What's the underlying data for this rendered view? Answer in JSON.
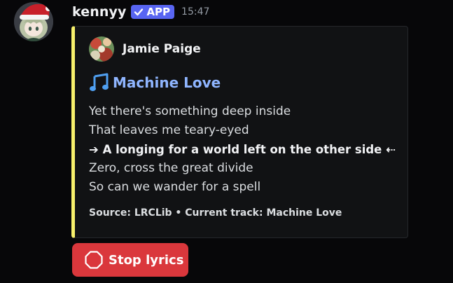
{
  "message": {
    "username": "kennyy",
    "app_tag": "APP",
    "timestamp": "15:47",
    "avatar_icon": "user-avatar-icon"
  },
  "embed": {
    "accent_color": "#f7f06b",
    "author": {
      "name": "Jamie Paige",
      "icon": "artist-avatar-icon"
    },
    "title": {
      "icon": "music-note-icon",
      "text": "Machine Love"
    },
    "lyrics": [
      "Yet there's something deep inside",
      "That leaves me teary-eyed",
      "➔ A longing for a world left on the other side ⇠",
      "Zero, cross the great divide",
      "So can we wander for a spell"
    ],
    "current_line_index": 2,
    "footer": "Source: LRCLib • Current track: Machine Love"
  },
  "stop_button": {
    "label": "Stop lyrics",
    "icon": "stop-octagon-icon",
    "color": "#da373c"
  },
  "colors": {
    "background": "#070709",
    "app_tag": "#5865f2",
    "title": "#8fb5ff"
  }
}
